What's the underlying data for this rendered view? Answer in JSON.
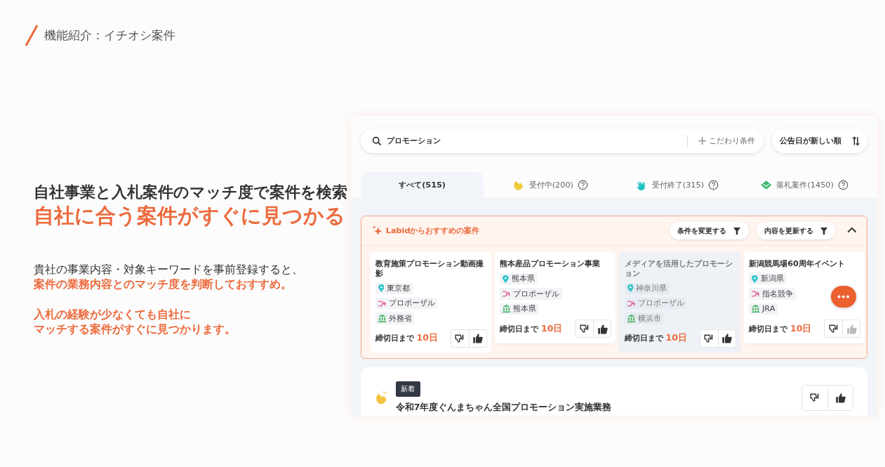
{
  "header": {
    "title": "機能紹介：イチオシ案件"
  },
  "intro": {
    "headline": "自社事業と入札案件のマッチ度で案件を検索",
    "headline_accent": "自社に合う案件がすぐに見つかる",
    "paragraphs": [
      {
        "lines": [
          {
            "text": "貴社の事業内容・対象キーワードを事前登録すると、",
            "accent": false
          },
          {
            "text": "案件の業務内容とのマッチ度を判断しておすすめ。",
            "accent": true
          }
        ]
      },
      {
        "lines": [
          {
            "text": "入札の経験が少なくても自社に",
            "accent": true
          },
          {
            "text": "マッチする案件がすぐに見つかります。",
            "accent": true
          }
        ]
      }
    ]
  },
  "app": {
    "search": {
      "value": "プロモーション",
      "filter_label": "こだわり条件"
    },
    "sort_button": "公告日が新しい順",
    "tabs": [
      {
        "label": "すべて(515)",
        "selected": true,
        "kind": "all"
      },
      {
        "label": "受付中(200)",
        "selected": false,
        "kind": "open"
      },
      {
        "label": "受付終了(315)",
        "selected": false,
        "kind": "closed"
      },
      {
        "label": "落札案件(1450)",
        "selected": false,
        "kind": "awarded"
      }
    ],
    "recommend": {
      "title": "Labidからおすすめの案件",
      "buttons": [
        "条件を変更する",
        "内容を更新する"
      ],
      "expanded": true,
      "cards": [
        {
          "title": "教育施策プロモーション動画撮影",
          "dimmed": false,
          "tags": [
            {
              "kind": "location",
              "text": "東京都"
            },
            {
              "kind": "method",
              "text": "プロポーザル"
            },
            {
              "kind": "org",
              "text": "外務省"
            }
          ],
          "deadline_label": "締切日まで",
          "deadline": "10日"
        },
        {
          "title": "熊本産品プロモーション事業",
          "dimmed": false,
          "tags": [
            {
              "kind": "location",
              "text": "熊本県"
            },
            {
              "kind": "method",
              "text": "プロポーザル"
            },
            {
              "kind": "org",
              "text": "熊本県"
            }
          ],
          "deadline_label": "締切日まで",
          "deadline": "10日"
        },
        {
          "title": "メディアを活用したプロモーション",
          "dimmed": true,
          "tags": [
            {
              "kind": "location",
              "text": "神奈川県"
            },
            {
              "kind": "method",
              "text": "プロポーザル"
            },
            {
              "kind": "org",
              "text": "横浜市"
            }
          ],
          "deadline_label": "締切日まで",
          "deadline": "10日"
        },
        {
          "title": "新潟競馬場60周年イベント",
          "dimmed": false,
          "tags": [
            {
              "kind": "location",
              "text": "新潟県"
            },
            {
              "kind": "method",
              "text": "指名競争"
            },
            {
              "kind": "org",
              "text": "JRA"
            }
          ],
          "deadline_label": "締切日まで",
          "deadline": "10日"
        }
      ]
    },
    "listing": {
      "badge": "新着",
      "title": "令和7年度ぐんまちゃん全国プロモーション実施業務"
    }
  }
}
